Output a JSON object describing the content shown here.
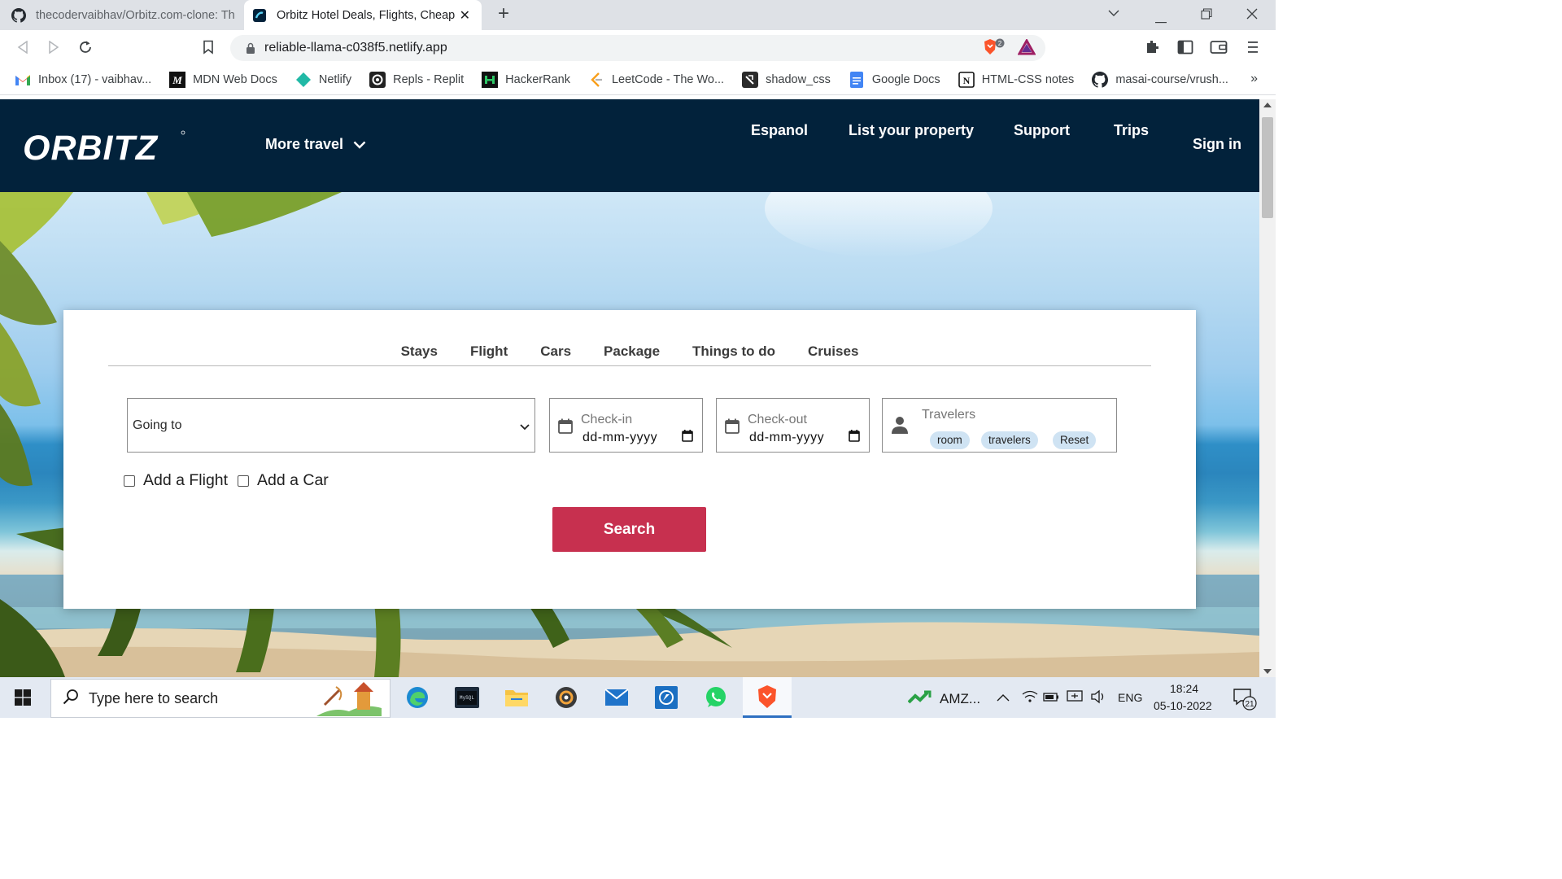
{
  "browser": {
    "tabs": [
      {
        "title": "thecodervaibhav/Orbitz.com-clone: Th",
        "icon": "github-icon",
        "active": false
      },
      {
        "title": "Orbitz Hotel Deals, Flights, Cheap",
        "icon": "orbitz-favicon-icon",
        "active": true
      }
    ],
    "new_tab": "+",
    "url": "reliable-llama-c038f5.netlify.app",
    "brave_shield_count": "2",
    "bookmarks": [
      {
        "label": "Inbox (17) - vaibhav...",
        "icon": "gmail-icon",
        "color": "#ea4335"
      },
      {
        "label": "MDN Web Docs",
        "icon": "mdn-icon",
        "color": "#000000"
      },
      {
        "label": "Netlify",
        "icon": "netlify-icon",
        "color": "#21b9a6"
      },
      {
        "label": "Repls - Replit",
        "icon": "replit-icon",
        "color": "#222222"
      },
      {
        "label": "HackerRank",
        "icon": "hackerrank-icon",
        "color": "#111111"
      },
      {
        "label": "LeetCode - The Wo...",
        "icon": "leetcode-icon",
        "color": "#f89f1b"
      },
      {
        "label": "shadow_css",
        "icon": "shadow-css-icon",
        "color": "#2b2b2b"
      },
      {
        "label": "Google Docs",
        "icon": "google-docs-icon",
        "color": "#4285f4"
      },
      {
        "label": "HTML-CSS notes",
        "icon": "notion-icon",
        "color": "#111111"
      },
      {
        "label": "masai-course/vrush...",
        "icon": "github-icon",
        "color": "#111111"
      }
    ],
    "bookmarks_more": "»"
  },
  "site": {
    "logo": "ORBITZ",
    "more_travel": "More travel",
    "nav": {
      "espanol": "Espanol",
      "list_property": "List your property",
      "support": "Support",
      "trips": "Trips",
      "sign_in": "Sign in"
    },
    "header_color": "#02223b",
    "search_tabs": [
      "Stays",
      "Flight",
      "Cars",
      "Package",
      "Things to do",
      "Cruises"
    ],
    "going_to": "Going to",
    "check_in_label": "Check-in",
    "check_in_value": "dd-mm-yyyy",
    "check_out_label": "Check-out",
    "check_out_value": "dd-mm-yyyy",
    "travelers_label": "Travelers",
    "chips": [
      "room",
      "travelers",
      "Reset"
    ],
    "add_flight": "Add a Flight",
    "add_car": "Add a Car",
    "search_button": "Search",
    "accent_color": "#c7304f"
  },
  "taskbar": {
    "search_placeholder": "Type here to search",
    "stock": "AMZ...",
    "language": "ENG",
    "time": "18:24",
    "date": "05-10-2022",
    "notifications": "21"
  }
}
